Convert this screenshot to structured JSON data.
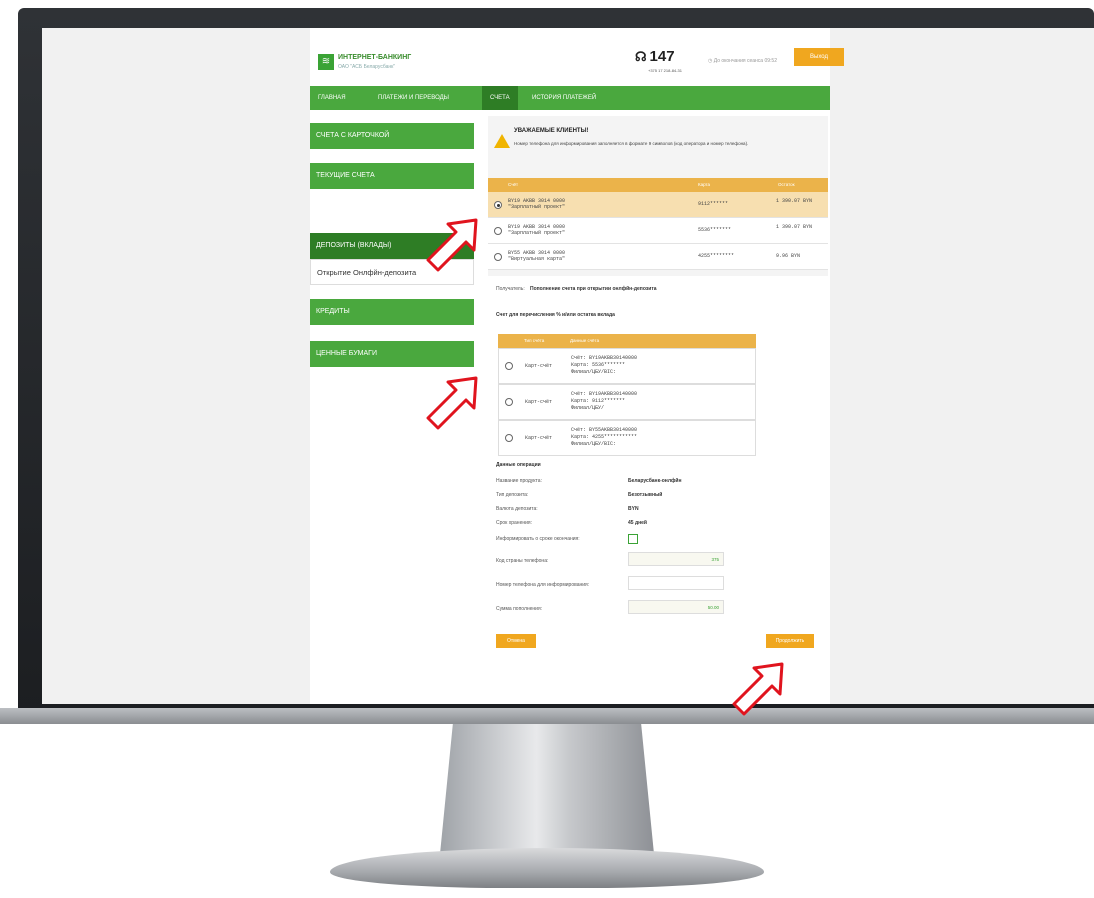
{
  "header": {
    "logo_title": "ИНТЕРНЕТ-БАНКИНГ",
    "logo_subtitle": "ОАО \"АСБ Беларусбанк\"",
    "phone_number": "147",
    "phone_sub": "+375 17 218-84-31",
    "session_text": "До окончания сеанса 09:52",
    "exit_label": "Выход"
  },
  "nav": {
    "items": [
      "ГЛАВНАЯ",
      "ПЛАТЕЖИ И ПЕРЕВОДЫ",
      "СЧЕТА",
      "ИСТОРИЯ ПЛАТЕЖЕЙ"
    ],
    "active": "СЧЕТА"
  },
  "sidebar": {
    "items": [
      "СЧЕТА С КАРТОЧКОЙ",
      "ТЕКУЩИЕ СЧЕТА",
      "ДЕПОЗИТЫ (ВКЛАДЫ)",
      "КРЕДИТЫ",
      "ЦЕННЫЕ БУМАГИ"
    ],
    "sub_item": "Открытие Онлфйн-депозита"
  },
  "notice": {
    "title": "УВАЖАЕМЫЕ КЛИЕНТЫ!",
    "text": "Номер телефона для информирования заполняется в формате 9 символов (код оператора и номер телефона)."
  },
  "accounts": {
    "headers": [
      "Счёт",
      "Карта",
      "Остаток"
    ],
    "rows": [
      {
        "account": "BY19 AKBB 3014 0000",
        "name": "\"Зарплатный проект\"",
        "card": "9112******",
        "balance": "1 390.07 BYN",
        "selected": true
      },
      {
        "account": "BY19 AKBB 3014 0000",
        "name": "\"Зарплатный проект\"",
        "card": "5536*******",
        "balance": "1 390.07 BYN",
        "selected": false
      },
      {
        "account": "BY55 AKBB 3014 0000",
        "name": "\"Виртуальная карта\"",
        "card": "4255********",
        "balance": "9.96 BYN",
        "selected": false
      }
    ]
  },
  "form": {
    "recipient_label": "Получатель:",
    "recipient_value": "Пополнение счета при открытии онлфйн-депозита",
    "interest_title": "Счет для перечисления % и/или остатка вклада",
    "sub_headers": [
      "Тип счёта",
      "Данные счёта"
    ],
    "sub_rows": [
      {
        "type": "Карт-счёт",
        "line1": "Счёт: BY19AKBB30140000",
        "line2": "Карта: 5536*******",
        "line3": "Филиал/ЦБУ/BIC:"
      },
      {
        "type": "Карт-счёт",
        "line1": "Счёт: BY19AKBB30140000",
        "line2": "Карта: 9112*******",
        "line3": "Филиал/ЦБУ/"
      },
      {
        "type": "Карт-счёт",
        "line1": "Счёт: BY55AKBB30140000",
        "line2": "Карта: 4255***********",
        "line3": "Филиал/ЦБУ/BIC:"
      }
    ],
    "operation_title": "Данные операции",
    "fields": [
      {
        "label": "Название продукта:",
        "value": "Беларусбанк-онлфйн"
      },
      {
        "label": "Тип депозита:",
        "value": "Безотзывный"
      },
      {
        "label": "Валюта депозита:",
        "value": "BYN"
      },
      {
        "label": "Срок хранения:",
        "value": "45 дней"
      }
    ],
    "notify_label": "Информировать о сроке окончания:",
    "country_code_label": "Код страны телефона:",
    "country_code_value": "375",
    "phone_label": "Номер телефона для информирования:",
    "phone_value": "",
    "amount_label": "Сумма пополнения:",
    "amount_value": "50.00",
    "cancel_label": "Отмена",
    "continue_label": "Продолжить"
  },
  "colors": {
    "green": "#4aa83e",
    "dark_green": "#2e7d25",
    "orange": "#f0a71f",
    "table_header": "#ebb34a",
    "arrow": "#e0141e"
  },
  "icons": [
    "headset-icon",
    "clock-icon",
    "warning-icon",
    "arrow-pointer-icon"
  ]
}
